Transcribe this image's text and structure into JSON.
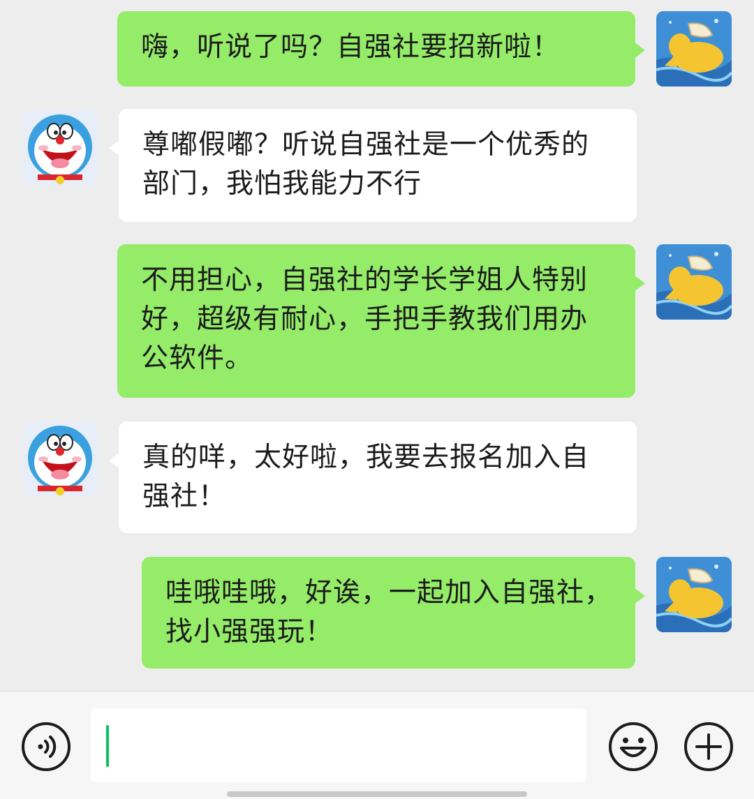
{
  "conversation": {
    "messages": [
      {
        "direction": "out",
        "text": "嗨，听说了吗？自强社要招新啦！"
      },
      {
        "direction": "in",
        "text": "尊嘟假嘟？听说自强社是一个优秀的部门，我怕我能力不行"
      },
      {
        "direction": "out",
        "text": "不用担心，自强社的学长学姐人特别好，超级有耐心，手把手教我们用办公软件。"
      },
      {
        "direction": "in",
        "text": "真的咩，太好啦，我要去报名加入自强社！"
      },
      {
        "direction": "out",
        "text": "哇哦哇哦，好诶，一起加入自强社，找小强强玩！"
      }
    ]
  },
  "composer": {
    "input_value": "",
    "voice_icon": "voice-icon",
    "emoji_icon": "smiley-face-icon",
    "more_icon": "plus-circle-icon"
  },
  "colors": {
    "outgoing_bubble": "#95ec69",
    "incoming_bubble": "#ffffff",
    "background": "#ededed",
    "caret": "#07c160"
  }
}
